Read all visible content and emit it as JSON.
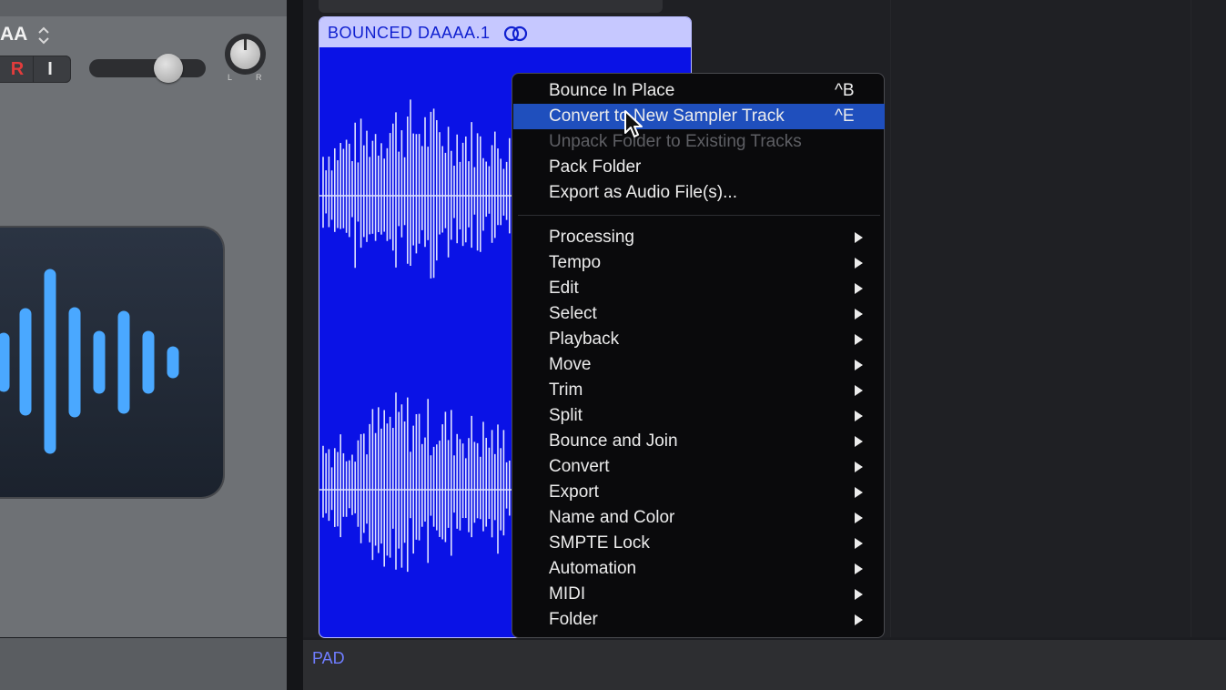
{
  "track_header": {
    "name": "AA",
    "record_label": "R",
    "input_monitor_label": "I",
    "pan_left_label": "L",
    "pan_right_label": "R"
  },
  "region": {
    "name": "BOUNCED DAAAA.1",
    "color": "#0a12e6",
    "header_color": "#c6c8ff"
  },
  "lanes": {
    "next_track_label": "PAD"
  },
  "context_menu": {
    "items": [
      {
        "label": "Bounce In Place",
        "shortcut": "^B"
      },
      {
        "label": "Convert to New Sampler Track",
        "shortcut": "^E",
        "highlighted": true
      },
      {
        "label": "Unpack Folder to Existing Tracks",
        "disabled": true
      },
      {
        "label": "Pack Folder"
      },
      {
        "label": "Export as Audio File(s)..."
      }
    ],
    "submenus": [
      {
        "label": "Processing"
      },
      {
        "label": "Tempo"
      },
      {
        "label": "Edit"
      },
      {
        "label": "Select"
      },
      {
        "label": "Playback"
      },
      {
        "label": "Move"
      },
      {
        "label": "Trim"
      },
      {
        "label": "Split"
      },
      {
        "label": "Bounce and Join"
      },
      {
        "label": "Convert"
      },
      {
        "label": "Export"
      },
      {
        "label": "Name and Color"
      },
      {
        "label": "SMPTE Lock"
      },
      {
        "label": "Automation"
      },
      {
        "label": "MIDI"
      },
      {
        "label": "Folder"
      }
    ],
    "highlight_color": "#1f4fbd"
  },
  "icons": {
    "loop": "loop-link-icon",
    "track": "audio-waveform-icon",
    "cursor": "mouse-pointer-icon",
    "stepper": "updown-chevron-icon",
    "submenu": "submenu-arrow-icon"
  }
}
